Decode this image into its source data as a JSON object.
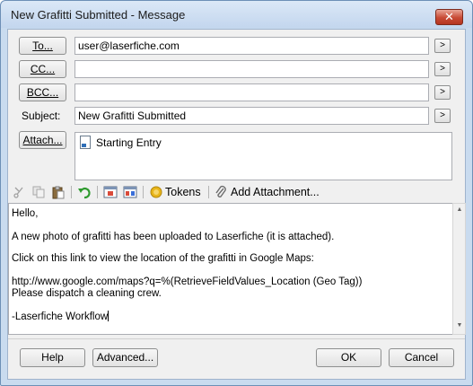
{
  "window": {
    "title": "New Grafitti Submitted - Message",
    "close_glyph": "✕"
  },
  "recipients": {
    "to_label": "To...",
    "to_value": "user@laserfiche.com",
    "cc_label": "CC...",
    "cc_value": "",
    "bcc_label": "BCC...",
    "bcc_value": "",
    "more_glyph": ">"
  },
  "subject": {
    "label": "Subject:",
    "value": "New Grafitti Submitted"
  },
  "attach": {
    "label": "Attach...",
    "items": [
      {
        "name": "Starting Entry",
        "icon": "document-icon"
      }
    ]
  },
  "toolbar": {
    "cut_icon": "scissors-icon",
    "copy_icon": "copy-icon",
    "paste_icon": "paste-icon",
    "undo_icon": "undo-icon",
    "insert_icon": "insert-field-icon",
    "format_icon": "format-icon",
    "tokens_label": "Tokens",
    "add_attachment_label": "Add Attachment..."
  },
  "body": {
    "lines": [
      "Hello,",
      "A new photo of grafitti has been uploaded to Laserfiche (it is attached).",
      "Click on this link to view the location of the grafitti in Google Maps:",
      "http://www.google.com/maps?q=%(RetrieveFieldValues_Location (Geo Tag))",
      "Please dispatch a cleaning crew.",
      "-Laserfiche Workflow"
    ]
  },
  "footer": {
    "help_label": "Help",
    "advanced_label": "Advanced...",
    "ok_label": "OK",
    "cancel_label": "Cancel"
  },
  "colors": {
    "title_bar": "#c3d6ee",
    "close_button": "#c84a35",
    "undo_green": "#2e9a2e",
    "token_gold": "#e8b51a"
  }
}
